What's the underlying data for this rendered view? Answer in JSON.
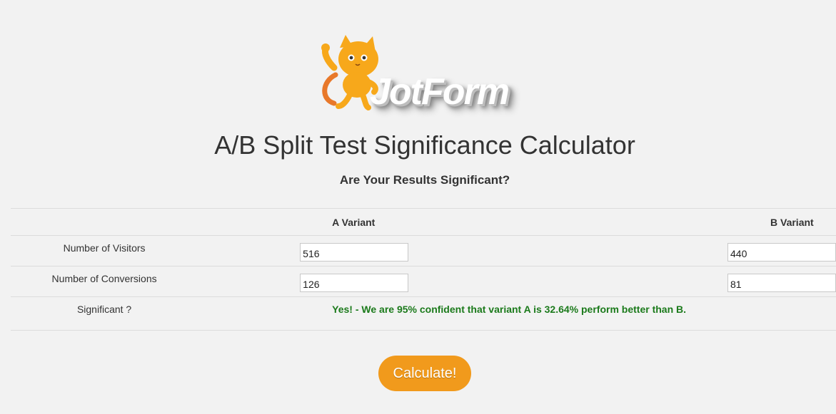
{
  "brand": {
    "logo_text": "JotForm",
    "mascot_icon": "cat-mascot-icon"
  },
  "header": {
    "title": "A/B Split Test Significance Calculator",
    "subtitle": "Are Your Results Significant?"
  },
  "table": {
    "columns": [
      "",
      "A Variant",
      "B Variant"
    ],
    "rows": {
      "visitors": {
        "label": "Number of Visitors",
        "a_value": "516",
        "b_value": "440"
      },
      "conversions": {
        "label": "Number of Conversions",
        "a_value": "126",
        "b_value": "81"
      },
      "significant": {
        "label": "Significant ?",
        "result": "Yes! - We are 95% confident that variant A is 32.64% perform better than B."
      }
    }
  },
  "actions": {
    "calculate_label": "Calculate!"
  },
  "colors": {
    "background": "#f2f2f2",
    "result_green": "#1b7a1b",
    "button_orange": "#f19a1c",
    "mascot_orange": "#f7a81b"
  }
}
